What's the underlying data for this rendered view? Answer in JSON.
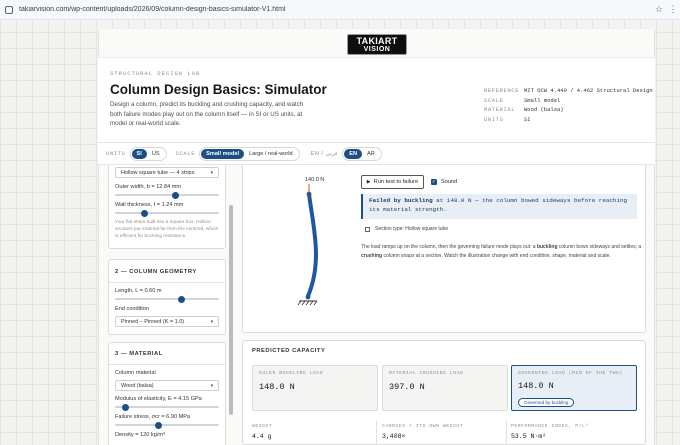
{
  "browser": {
    "url": "takiarvision.com/wp-content/uploads/2026/09/column-design-basics-simulator-V1.html",
    "icons": [
      "site-icon",
      "star-icon",
      "menu-icon"
    ]
  },
  "logo": {
    "line1": "TAKIART",
    "line2": "VISION"
  },
  "header": {
    "eyebrow": "STRUCTURAL DESIGN LAB",
    "title": "Column Design Basics: Simulator",
    "intro": "Design a column, predict its buckling and crushing capacity, and watch both failure modes play out on the column itself — in SI or US units, at model or real-world scale.",
    "meta": [
      {
        "key": "REFERENCE",
        "value": "MIT OCW 4.440 / 4.462 Structural Design"
      },
      {
        "key": "SCALE",
        "value": "Small model"
      },
      {
        "key": "MATERIAL",
        "value": "Wood (balsa)"
      },
      {
        "key": "UNITS",
        "value": "SI"
      }
    ]
  },
  "controls": {
    "units_label": "UNITS",
    "units": [
      "SI",
      "US"
    ],
    "units_selected": "SI",
    "scale_label": "SCALE",
    "scale": [
      "Small model",
      "Large / real-world"
    ],
    "scale_selected": "Small model",
    "lang_label": "EN / عربي",
    "lang": [
      "EN",
      "AR"
    ],
    "lang_selected": "EN"
  },
  "sidebar": {
    "section_select": "Hollow square tube — 4 strips",
    "outer_width_label": "Outer width, b = 12.84 mm",
    "outer_width_pct": 0.58,
    "wall_label": "Wall thickness, t = 1.24 mm",
    "wall_pct": 0.28,
    "wall_note": "Your flat strips built into a square box. Hollow sections put material far from the centroid, which is efficient for buckling resistance.",
    "geometry": {
      "heading": "2 — COLUMN GEOMETRY",
      "length_label": "Length, L = 0.60 m",
      "length_pct": 0.64,
      "end_label": "End condition",
      "end_value": "Pinned – Pinned (K = 1.0)"
    },
    "material": {
      "heading": "3 — MATERIAL",
      "col_label": "Column material",
      "col_value": "Wood (balsa)",
      "modulus_label": "Modulus of elasticity, E = 4.15 GPa",
      "modulus_pct": 0.1,
      "stress_label": "Failure stress, σcr = 6.90 MPa",
      "stress_pct": 0.42,
      "density_label": "Density = 120 kg/m³"
    }
  },
  "viz": {
    "load_label": "140.0 N",
    "run_label": "Run test to failure",
    "sound_label": "Sound",
    "fail_bold": "Failed by buckling",
    "fail_rest": " at 148.0 N — the column bowed sideways before reaching its material strength.",
    "section_type": "Section type: Hollow square tube",
    "explain_pre": "The load ramps up on the column, then the governing failure mode plays out: a ",
    "explain_b1": "buckling",
    "explain_mid": " column bows sideways and settles; a ",
    "explain_b2": "crushing",
    "explain_post": " column snaps at a section. Watch the illustration change with end condition, shape, material and scale."
  },
  "predicted": {
    "heading": "PREDICTED CAPACITY",
    "cards": [
      {
        "label": "EULER BUCKLING LOAD",
        "value": "148.0 N"
      },
      {
        "label": "MATERIAL CRUSHING LOAD",
        "value": "397.0 N"
      },
      {
        "label": "GOVERNING LOAD (MIN OF THE TWO)",
        "value": "148.0 N",
        "badge": "Governed by buckling"
      }
    ],
    "row": [
      {
        "label": "WEIGHT",
        "value": "4.4 g"
      },
      {
        "label": "CARRIES × ITS OWN WEIGHT",
        "value": "3,408×"
      },
      {
        "label": "PERFORMANCE INDEX, P/L²",
        "value": "53.5 N·m²"
      }
    ]
  },
  "colors": {
    "accent": "#1d4f86",
    "column": "#1f57a3",
    "load_marker": "#d9733a"
  }
}
